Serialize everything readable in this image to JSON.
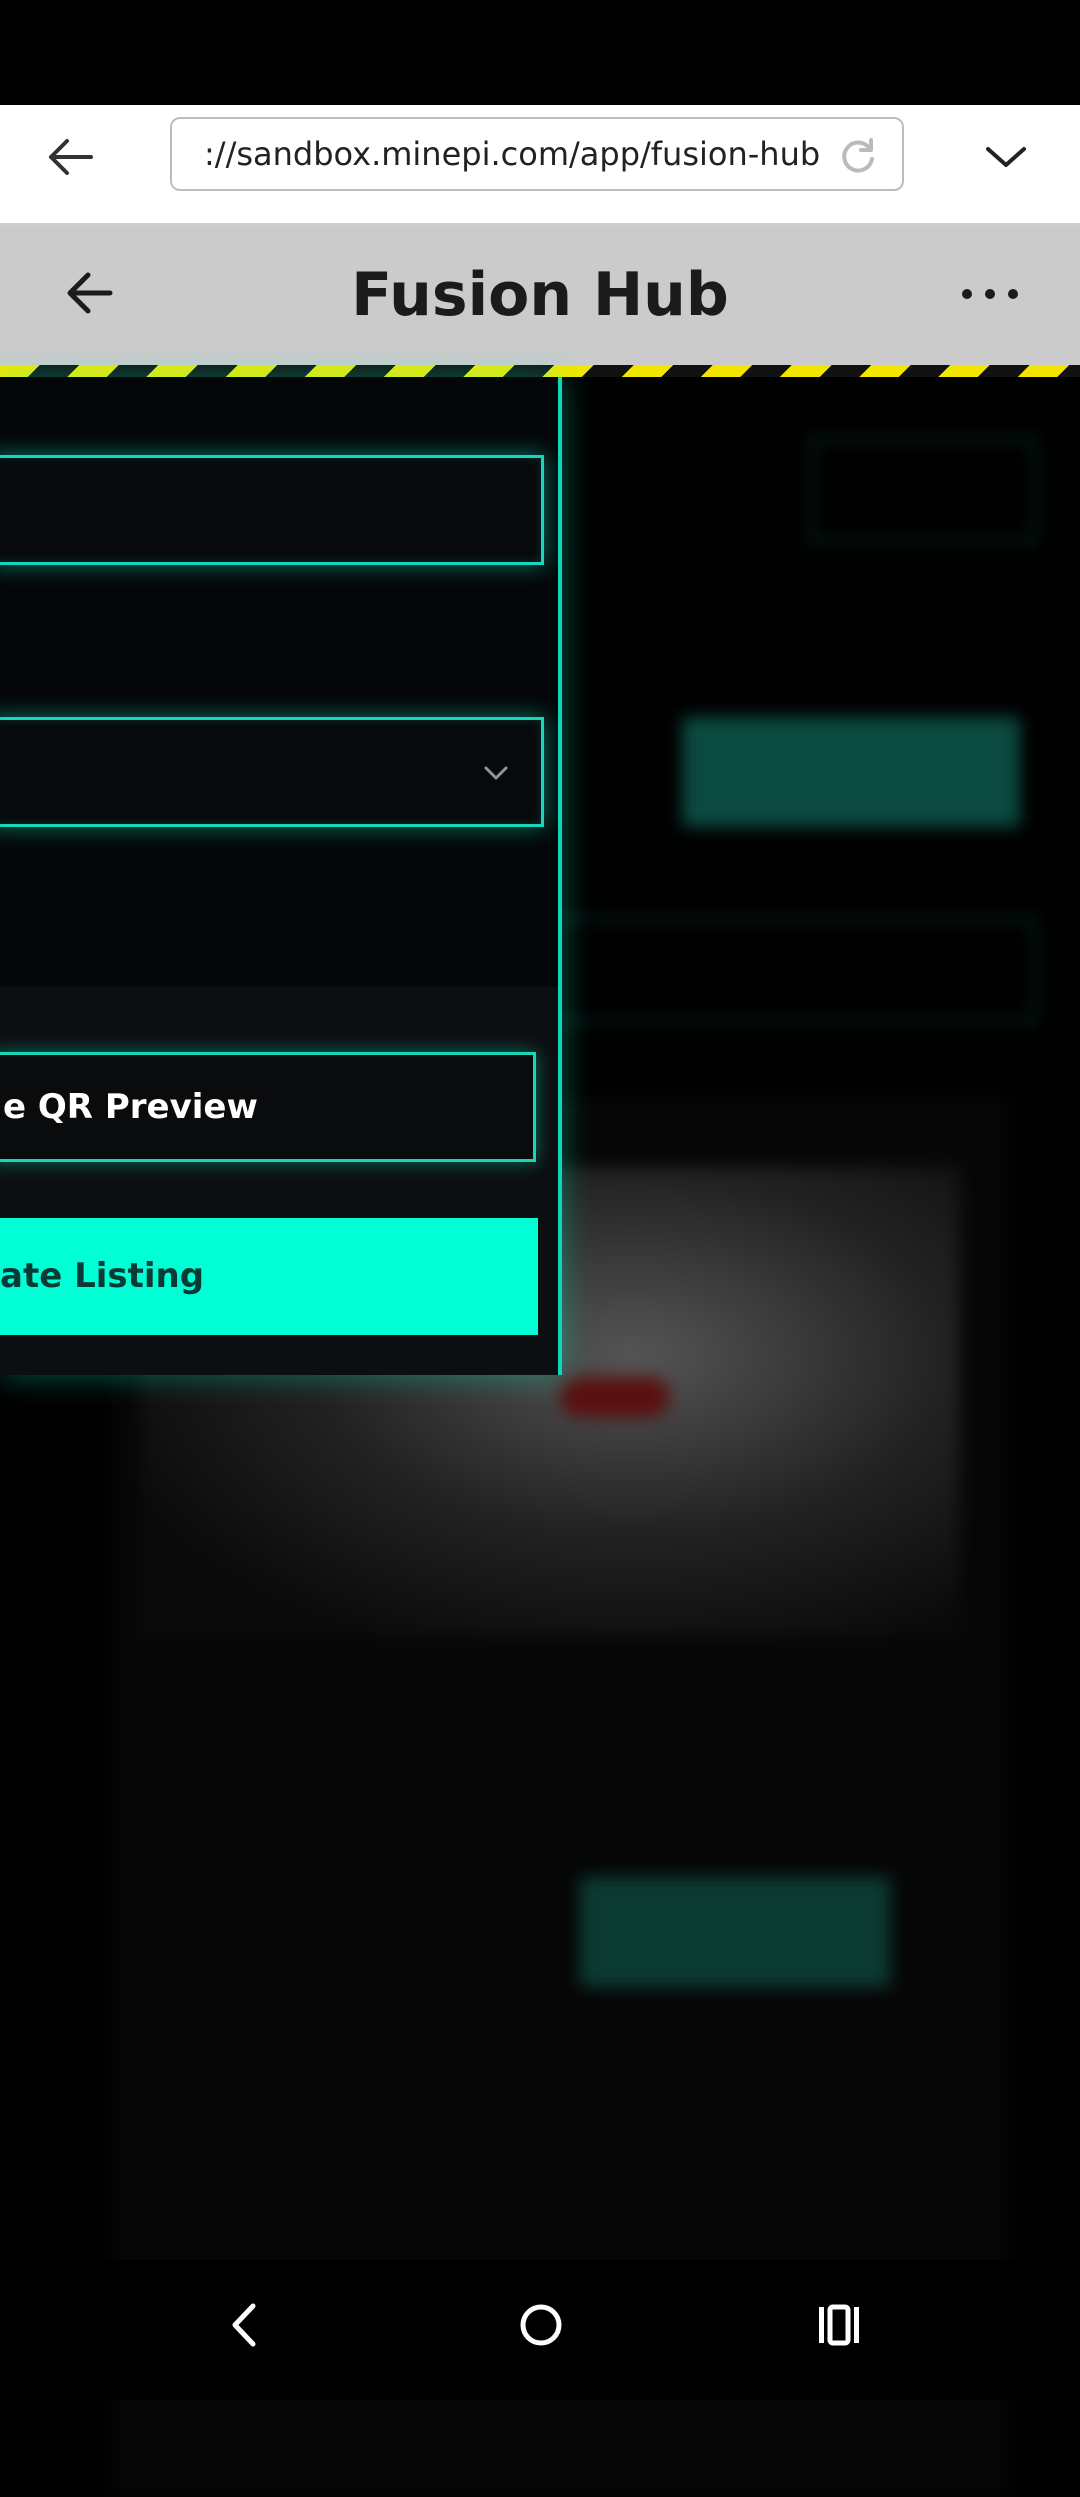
{
  "browser": {
    "url": "://sandbox.minepi.com/app/fusion-hub"
  },
  "app": {
    "title": "Fusion Hub"
  },
  "panel": {
    "qr_button_label": "e QR Preview",
    "create_button_label": "ate Listing"
  },
  "icons": {
    "browser_back": "back-arrow-icon",
    "reload": "reload-icon",
    "tab_menu": "chevron-down-icon",
    "app_back": "back-arrow-icon",
    "more": "more-dots-icon",
    "select_chevron": "chevron-down-icon",
    "nav_back": "nav-back-icon",
    "nav_home": "nav-home-icon",
    "nav_recent": "nav-recent-apps-icon"
  },
  "colors": {
    "accent": "#00ffd5",
    "field_border": "#17d6b9",
    "header_bg": "#cbcbcb",
    "hazard_yellow": "#f2e600"
  }
}
